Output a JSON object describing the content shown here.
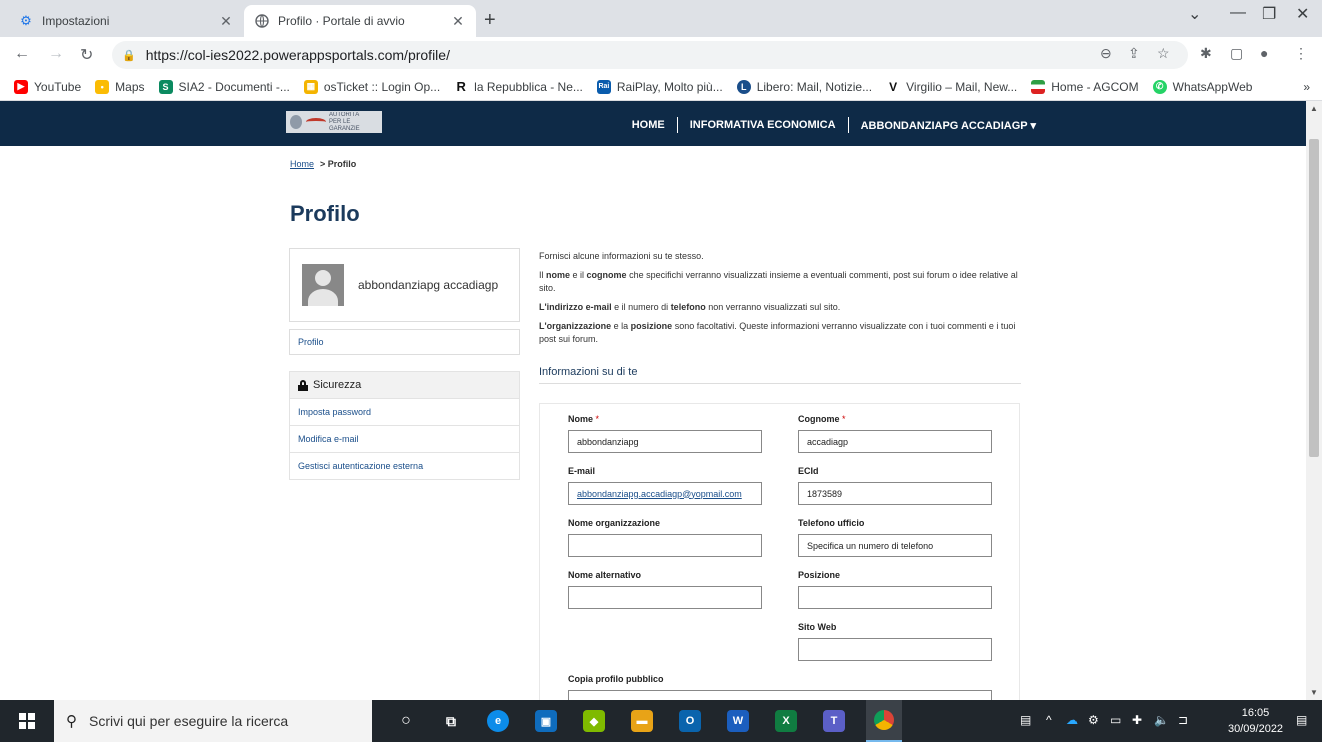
{
  "browser": {
    "tabs": [
      {
        "label": "Impostazioni",
        "icon": "gear-icon"
      },
      {
        "label": "Profilo · Portale di avvio",
        "icon": "globe-icon"
      }
    ],
    "url": "https://col-ies2022.powerappsportals.com/profile/",
    "bookmarks": [
      {
        "label": "YouTube",
        "color": "#ff0000"
      },
      {
        "label": "Maps",
        "color": "#fbbc04"
      },
      {
        "label": "SIA2 - Documenti -...",
        "color": "#0b8a60"
      },
      {
        "label": "osTicket :: Login Op...",
        "color": "#f4b400"
      },
      {
        "label": "la Repubblica - Ne...",
        "color": "#111111"
      },
      {
        "label": "RaiPlay, Molto più...",
        "color": "#0a5cad"
      },
      {
        "label": "Libero: Mail, Notizie...",
        "color": "#1a4e8a"
      },
      {
        "label": "Virgilio – Mail, New...",
        "color": "#111111"
      },
      {
        "label": "Home - AGCOM",
        "color": "#2e9e44"
      },
      {
        "label": "WhatsAppWeb",
        "color": "#25d366"
      }
    ],
    "more_bookmarks": "»"
  },
  "site": {
    "logo_text": "AUTORITÀ PER LE GARANZIE NELLE COMUNICAZIONI",
    "menu": [
      "HOME",
      "INFORMATIVA ECONOMICA",
      "ABBONDANZIAPG ACCADIAGP"
    ],
    "menu_caret": "▾",
    "breadcrumb": {
      "home": "Home",
      "current": "> Profilo"
    },
    "title": "Profilo"
  },
  "sidebar": {
    "user_name": "abbondanziapg accadiagp",
    "profile_link": "Profilo",
    "security_heading": "Sicurezza",
    "security_items": [
      "Imposta password",
      "Modifica e-mail",
      "Gestisci autenticazione esterna"
    ]
  },
  "intro": {
    "line1": "Fornisci alcune informazioni su te stesso.",
    "line2_b1": "nome",
    "line2_b2": "cognome",
    "line2_p1": "Il ",
    "line2_p2": " e il ",
    "line2_p3": " che specifichi verranno visualizzati insieme a eventuali commenti, post sui forum o idee relative al sito.",
    "line3_b1": "L'indirizzo e-mail",
    "line3_b2": "telefono",
    "line3_p1": " e il numero di ",
    "line3_p2": " non verranno visualizzati sul sito.",
    "line4_b1": "L'organizzazione",
    "line4_b2": "posizione",
    "line4_p1": " e la ",
    "line4_p2": " sono facoltativi. Queste informazioni verranno visualizzate con i tuoi commenti e i tuoi post sui forum."
  },
  "form": {
    "section_title": "Informazioni su di te",
    "required_mark": "*",
    "fields": {
      "nome": {
        "label": "Nome",
        "value": "abbondanziapg"
      },
      "cognome": {
        "label": "Cognome",
        "value": "accadiagp"
      },
      "email": {
        "label": "E-mail",
        "value": "abbondanziapg.accadiagp@yopmail.com"
      },
      "ecid": {
        "label": "ECId",
        "value": "1873589"
      },
      "org": {
        "label": "Nome organizzazione",
        "value": ""
      },
      "tel": {
        "label": "Telefono ufficio",
        "value": "Specifica un numero di telefono"
      },
      "alt": {
        "label": "Nome alternativo",
        "value": ""
      },
      "pos": {
        "label": "Posizione",
        "value": ""
      },
      "web": {
        "label": "Sito Web",
        "value": ""
      },
      "copy": {
        "label": "Copia profilo pubblico",
        "value": ""
      }
    }
  },
  "taskbar": {
    "search_placeholder": "Scrivi qui per eseguire la ricerca",
    "time": "16:05",
    "date": "30/09/2022"
  }
}
